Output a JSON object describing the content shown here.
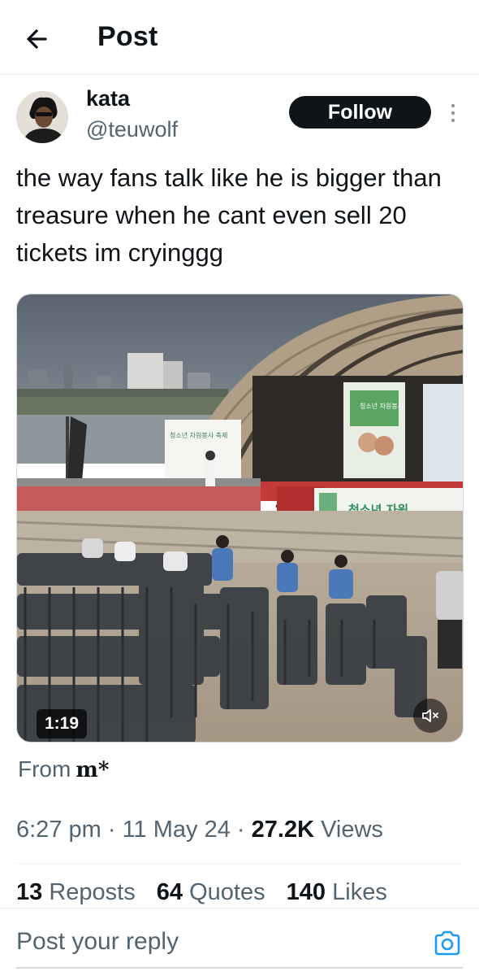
{
  "header": {
    "title": "Post",
    "back_icon": "arrow-left-icon"
  },
  "author": {
    "display_name": "kata",
    "handle": "@teuwolf",
    "follow_label": "Follow",
    "more_icon": "more-vertical-icon"
  },
  "post": {
    "text": "the way fans talk like he is bigger than treasure when he cant even sell 20 tickets im cryinggg"
  },
  "media": {
    "duration": "1:19",
    "mute_icon": "speaker-muted-icon",
    "sign_left": "청소년 자원봉사 축제",
    "sign_center": "청소년 자원봉사",
    "banner_text": "청소년 자원"
  },
  "source": {
    "prefix": "From",
    "name": "m*"
  },
  "meta": {
    "time": "6:27 pm",
    "sep1": " · ",
    "date": "11 May 24",
    "sep2": " · ",
    "views_count": "27.2K",
    "views_label": " Views"
  },
  "stats": {
    "reposts_count": "13",
    "reposts_label": " Reposts",
    "quotes_count": "64",
    "quotes_label": " Quotes",
    "likes_count": "140",
    "likes_label": " Likes"
  },
  "reply": {
    "placeholder": "Post your reply",
    "camera_icon": "camera-icon"
  },
  "colors": {
    "primary_text": "#0f1419",
    "secondary_text": "#536471",
    "accent": "#1d9bf0",
    "divider": "#eff3f4"
  }
}
